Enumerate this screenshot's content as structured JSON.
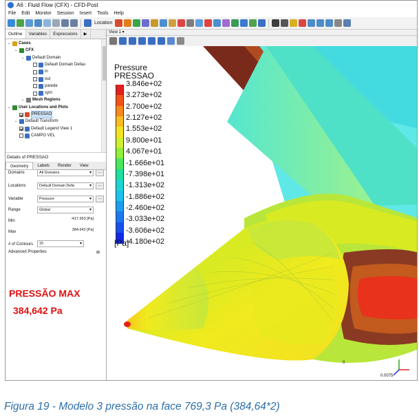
{
  "window": {
    "title": "A6 : Fluid Flow (CFX) - CFD-Post"
  },
  "menu": [
    "File",
    "Edit",
    "Monitor",
    "Session",
    "Insert",
    "Tools",
    "Help"
  ],
  "toolbar": {
    "location_label": "Location"
  },
  "panel_tabs": [
    "Outline",
    "Variables",
    "Expressions"
  ],
  "tree": [
    {
      "label": "Cases",
      "depth": 0,
      "bold": true,
      "checkbox": null,
      "icon": "cases-icon",
      "color": "#d9a21b"
    },
    {
      "label": "CFX",
      "depth": 1,
      "bold": true,
      "checkbox": null,
      "icon": "cfx-icon",
      "color": "#2f8a2f"
    },
    {
      "label": "Default Domain",
      "depth": 2,
      "bold": false,
      "checkbox": null,
      "icon": "domain-icon",
      "color": "#3b6fc2"
    },
    {
      "label": "Default Domain Defau",
      "depth": 3,
      "bold": false,
      "checkbox": false,
      "icon": "boundary-icon",
      "color": "#3b6fc2"
    },
    {
      "label": "in",
      "depth": 3,
      "bold": false,
      "checkbox": false,
      "icon": "boundary-icon",
      "color": "#3b6fc2"
    },
    {
      "label": "out",
      "depth": 3,
      "bold": false,
      "checkbox": false,
      "icon": "boundary-icon",
      "color": "#3b6fc2"
    },
    {
      "label": "parede",
      "depth": 3,
      "bold": false,
      "checkbox": false,
      "icon": "boundary-icon",
      "color": "#3b6fc2"
    },
    {
      "label": "sym",
      "depth": 3,
      "bold": false,
      "checkbox": false,
      "icon": "boundary-icon",
      "color": "#3b6fc2"
    },
    {
      "label": "Mesh Regions",
      "depth": 2,
      "bold": true,
      "checkbox": null,
      "icon": "mesh-icon",
      "color": "#7a7a7a"
    },
    {
      "label": "User Locations and Plots",
      "depth": 0,
      "bold": true,
      "checkbox": null,
      "icon": "user-locations-icon",
      "color": "#2f8a2f"
    },
    {
      "label": "PRESSAO",
      "depth": 1,
      "bold": false,
      "checkbox": true,
      "icon": "contour-icon",
      "color": "#d94a2a",
      "selected": true
    },
    {
      "label": "Default Transform",
      "depth": 1,
      "bold": false,
      "checkbox": null,
      "icon": "transform-icon",
      "color": "#3b6fc2"
    },
    {
      "label": "Default Legend View 1",
      "depth": 1,
      "bold": false,
      "checkbox": true,
      "icon": "legend-icon",
      "color": "#3b6fc2"
    },
    {
      "label": "CAMPO VEL",
      "depth": 1,
      "bold": false,
      "checkbox": false,
      "icon": "vector-icon",
      "color": "#3b6fc2"
    }
  ],
  "details": {
    "title": "Details of PRESSAO",
    "tabs": [
      "Geometry",
      "Labels",
      "Render",
      "View"
    ],
    "domains_label": "Domains",
    "domains_value": "All Domains",
    "locations_label": "Locations",
    "locations_value": "Default Domain Defa",
    "variable_label": "Variable",
    "variable_value": "Pressure",
    "range_label": "Range",
    "range_value": "Global",
    "min_label": "Min",
    "min_value": "-417.953 [Pa]",
    "max_label": "Max",
    "max_value": "384.642 [Pa]",
    "contours_label": "# of Contours",
    "contours_value": "15",
    "advanced_label": "Advanced Properties"
  },
  "annotation": {
    "line1": "PRESSÃO MAX",
    "line2": "384,642 Pa",
    "color": "#e01010"
  },
  "view": {
    "title": "View 1"
  },
  "legend": {
    "title_line1": "Pressure",
    "title_line2": "PRESSAO",
    "unit": "[Pa]",
    "labels": [
      "3.846e+02",
      "3.273e+02",
      "2.700e+02",
      "2.127e+02",
      "1.553e+02",
      "9.800e+01",
      "4.067e+01",
      "-1.666e+01",
      "-7.398e+01",
      "-1.313e+02",
      "-1.886e+02",
      "-2.460e+02",
      "-3.033e+02",
      "-3.606e+02",
      "-4.180e+02"
    ],
    "colors": [
      "#e5201c",
      "#f25418",
      "#f88a1a",
      "#fdbc1e",
      "#f3e41f",
      "#cdf02a",
      "#8df039",
      "#48e85c",
      "#1ee0a0",
      "#1ad6d4",
      "#1cc2ee",
      "#1a9ef0",
      "#1a78f0",
      "#1650ef",
      "#1028e8"
    ]
  },
  "scale": {
    "zero": "0",
    "end": "0.0075"
  },
  "caption": "Figura 19 - Modelo 3 pressão na face 769,3 Pa (384,64*2)"
}
